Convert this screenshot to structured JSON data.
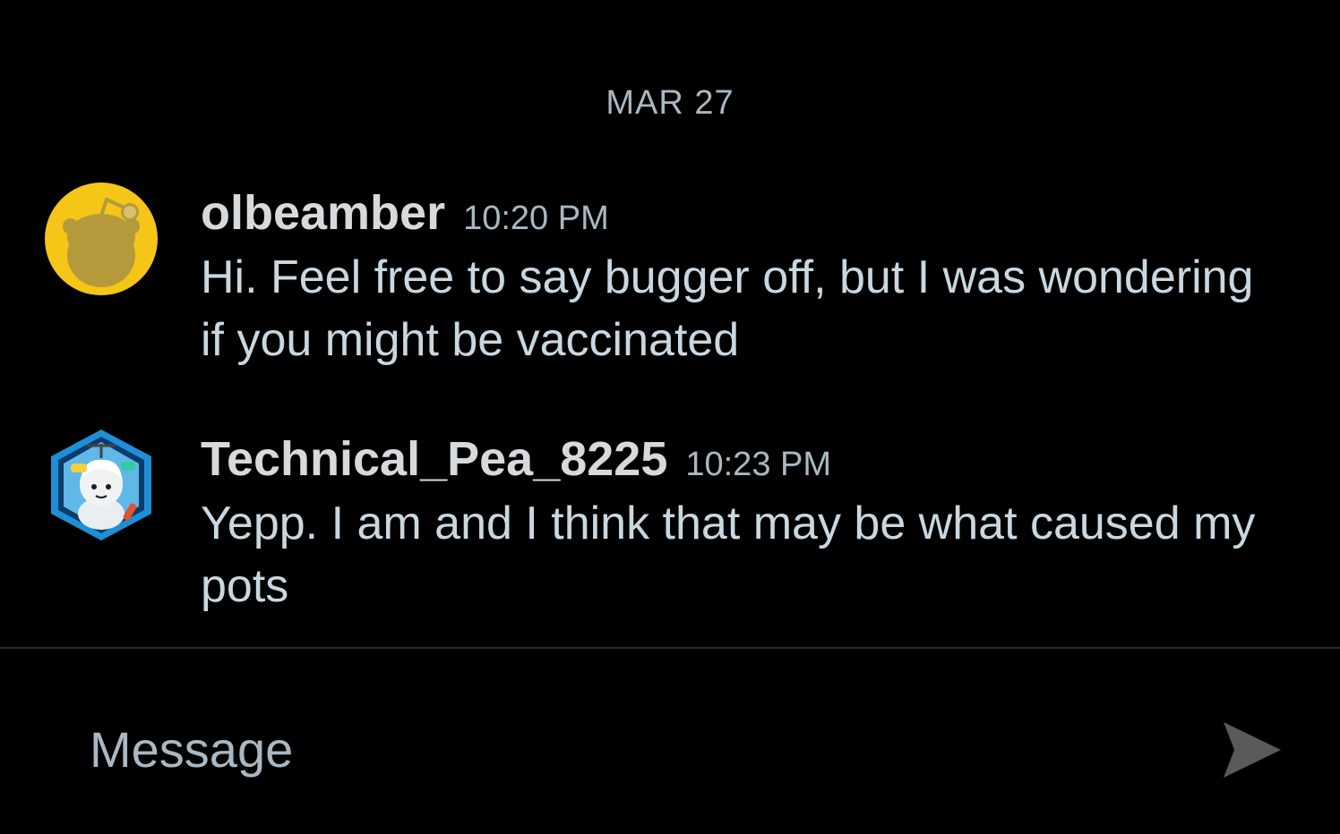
{
  "date_separator": "MAR 27",
  "messages": [
    {
      "username": "olbeamber",
      "time": "10:20 PM",
      "text": "Hi. Feel free to say bugger off, but I was wondering if you might be vaccinated",
      "avatar_icon": "snoo-avatar-icon",
      "avatar_color": "#f5c518"
    },
    {
      "username": "Technical_Pea_8225",
      "time": "10:23 PM",
      "text": "Yepp. I am and I think that may be what caused my pots",
      "avatar_icon": "custom-snoo-avatar-icon",
      "avatar_color": "#1e8fd6"
    }
  ],
  "composer": {
    "placeholder": "Message",
    "send_icon": "send-arrow-icon"
  },
  "colors": {
    "background": "#000000",
    "text": "#c9d7e0",
    "muted": "#a9b8c2",
    "divider": "#2a2a2c",
    "send_icon": "#5a5a5c"
  }
}
